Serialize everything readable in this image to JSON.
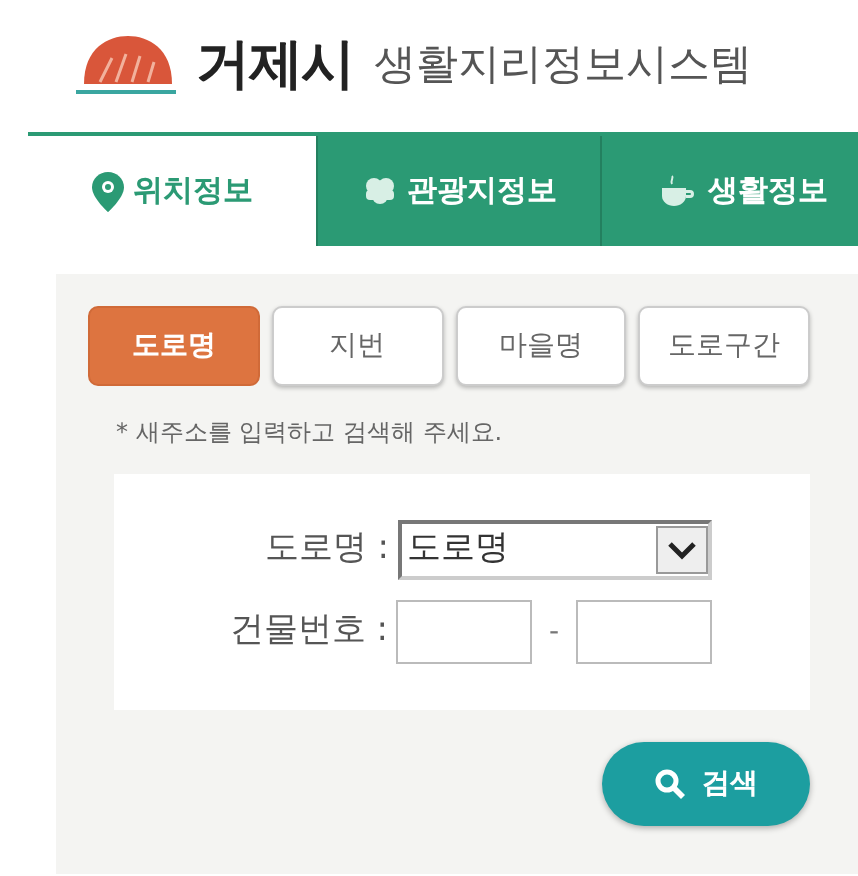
{
  "header": {
    "city": "거제시",
    "system": "생활지리정보시스템"
  },
  "tabs": [
    {
      "kind": "pin",
      "label": "위치정보",
      "selected": true
    },
    {
      "kind": "clover",
      "label": "관광지정보",
      "selected": false
    },
    {
      "kind": "cup",
      "label": "생활정보",
      "selected": false
    }
  ],
  "search_types": [
    {
      "label": "도로명",
      "selected": true
    },
    {
      "label": "지번",
      "selected": false
    },
    {
      "label": "마을명",
      "selected": false
    },
    {
      "label": "도로구간",
      "selected": false
    }
  ],
  "note": "* 새주소를 입력하고 검색해 주세요.",
  "form": {
    "road_label": "도로명 :",
    "road_value": "도로명",
    "building_label": "건물번호 :",
    "separator": "-"
  },
  "search_button": "검색"
}
